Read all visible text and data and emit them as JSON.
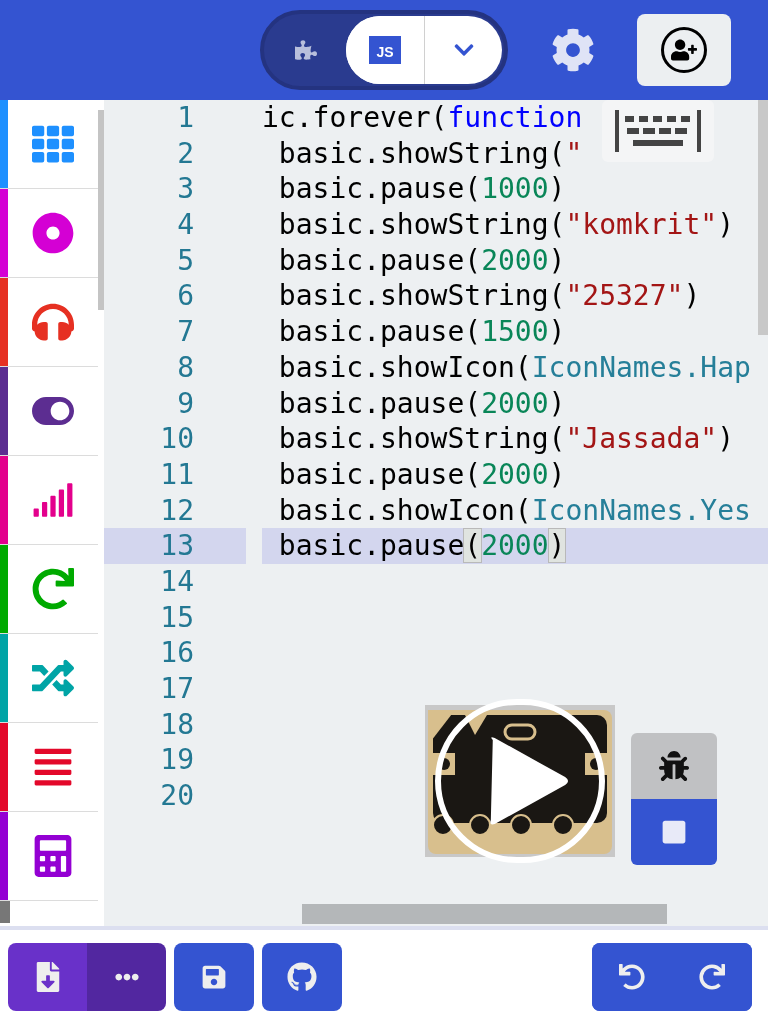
{
  "header": {
    "mode_toggle": [
      {
        "kind": "blocks",
        "selected": false
      },
      {
        "kind": "javascript",
        "label": "JS",
        "selected": true
      }
    ]
  },
  "toolbox": [
    {
      "color": "#1e90ff"
    },
    {
      "color": "#d400d4"
    },
    {
      "color": "#e63022"
    },
    {
      "color": "#5c2d91"
    },
    {
      "color": "#e3008c"
    },
    {
      "color": "#00aa00"
    },
    {
      "color": "#00a4a6"
    },
    {
      "color": "#e3082a"
    },
    {
      "color": "#9400d3"
    }
  ],
  "editor": {
    "lines": [
      {
        "number": "1",
        "selected": false,
        "tokens": [
          {
            "kind": "plain",
            "text": "ic.forever("
          },
          {
            "kind": "keyword",
            "text": "function"
          }
        ]
      },
      {
        "number": "2",
        "selected": false,
        "tokens": [
          {
            "kind": "plain",
            "text": " basic.showString("
          },
          {
            "kind": "string",
            "text": "\""
          }
        ]
      },
      {
        "number": "3",
        "selected": false,
        "tokens": [
          {
            "kind": "plain",
            "text": " basic.pause("
          },
          {
            "kind": "number",
            "text": "1000"
          },
          {
            "kind": "plain",
            "text": ")"
          }
        ]
      },
      {
        "number": "4",
        "selected": false,
        "tokens": [
          {
            "kind": "plain",
            "text": " basic.showString("
          },
          {
            "kind": "string",
            "text": "\"komkrit\""
          },
          {
            "kind": "plain",
            "text": ")"
          }
        ]
      },
      {
        "number": "5",
        "selected": false,
        "tokens": [
          {
            "kind": "plain",
            "text": " basic.pause("
          },
          {
            "kind": "number",
            "text": "2000"
          },
          {
            "kind": "plain",
            "text": ")"
          }
        ]
      },
      {
        "number": "6",
        "selected": false,
        "tokens": [
          {
            "kind": "plain",
            "text": " basic.showString("
          },
          {
            "kind": "string",
            "text": "\"25327\""
          },
          {
            "kind": "plain",
            "text": ")"
          }
        ]
      },
      {
        "number": "7",
        "selected": false,
        "tokens": [
          {
            "kind": "plain",
            "text": " basic.pause("
          },
          {
            "kind": "number",
            "text": "1500"
          },
          {
            "kind": "plain",
            "text": ")"
          }
        ]
      },
      {
        "number": "8",
        "selected": false,
        "tokens": [
          {
            "kind": "plain",
            "text": " basic.showIcon("
          },
          {
            "kind": "enum",
            "text": "IconNames.Hap"
          }
        ]
      },
      {
        "number": "9",
        "selected": false,
        "tokens": [
          {
            "kind": "plain",
            "text": " basic.pause("
          },
          {
            "kind": "number",
            "text": "2000"
          },
          {
            "kind": "plain",
            "text": ")"
          }
        ]
      },
      {
        "number": "10",
        "selected": false,
        "tokens": [
          {
            "kind": "plain",
            "text": " basic.showString("
          },
          {
            "kind": "string",
            "text": "\"Jassada\""
          },
          {
            "kind": "plain",
            "text": ")"
          }
        ]
      },
      {
        "number": "11",
        "selected": false,
        "tokens": [
          {
            "kind": "plain",
            "text": " basic.pause("
          },
          {
            "kind": "number",
            "text": "2000"
          },
          {
            "kind": "plain",
            "text": ")"
          }
        ]
      },
      {
        "number": "12",
        "selected": false,
        "tokens": [
          {
            "kind": "plain",
            "text": " basic.showIcon("
          },
          {
            "kind": "enum",
            "text": "IconNames.Yes"
          }
        ]
      },
      {
        "number": "13",
        "selected": true,
        "tokens": [
          {
            "kind": "plain",
            "text": " basic.pause"
          },
          {
            "kind": "bracket",
            "text": "("
          },
          {
            "kind": "number",
            "text": "2000"
          },
          {
            "kind": "bracket",
            "text": ")"
          }
        ]
      },
      {
        "number": "14",
        "selected": false
      },
      {
        "number": "15",
        "selected": false
      },
      {
        "number": "16",
        "selected": false
      },
      {
        "number": "17",
        "selected": false
      },
      {
        "number": "18",
        "selected": false
      },
      {
        "number": "19",
        "selected": false
      },
      {
        "number": "20",
        "selected": false
      }
    ]
  }
}
